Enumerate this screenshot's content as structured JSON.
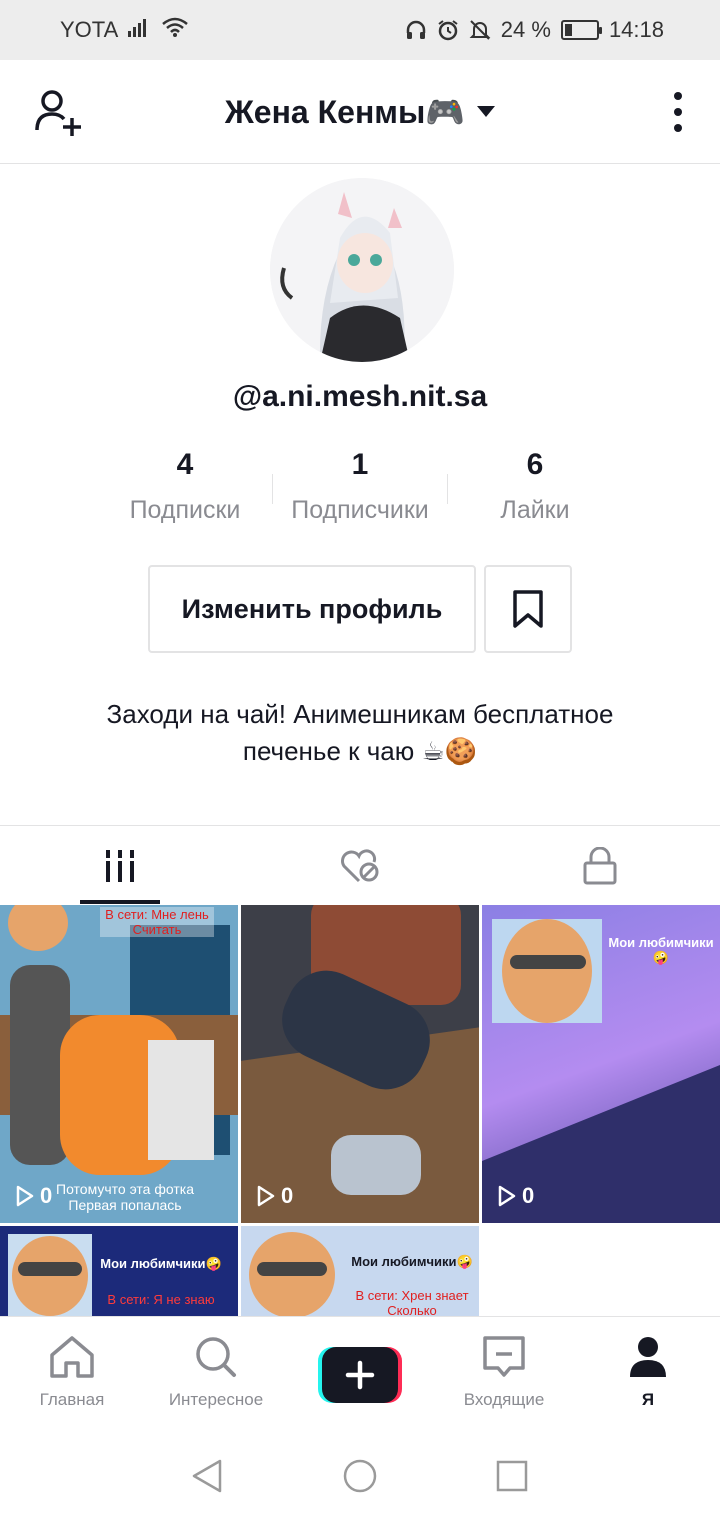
{
  "status_bar": {
    "carrier": "YOTA",
    "battery": "24 %",
    "battery_level": 0.24,
    "time": "14:18"
  },
  "header": {
    "title": "Жена Кенмы🎮",
    "icons": [
      "add-user-icon",
      "caret-down-icon",
      "more-vertical-icon"
    ]
  },
  "profile": {
    "username": "@a.ni.mesh.nit.sa",
    "stats": [
      {
        "value": "4",
        "label": "Подписки"
      },
      {
        "value": "1",
        "label": "Подписчики"
      },
      {
        "value": "6",
        "label": "Лайки"
      }
    ],
    "edit_button": "Изменить профиль",
    "bio_line1": "Заходи на чай! Анимешникам бесплатное",
    "bio_line2": "печенье к чаю ☕🍪"
  },
  "tabs": {
    "icons": [
      "grid-icon",
      "liked-icon",
      "lock-icon"
    ],
    "active": 0
  },
  "videos": [
    {
      "views": "0",
      "top_caption": "В сети: Мне лень Считать",
      "bottom_caption_1": "Потомучто эта фотка",
      "bottom_caption_2": "Первая попалась"
    },
    {
      "views": "0"
    },
    {
      "views": "0",
      "top_caption": "Мои любимчики🤪"
    },
    {
      "top_caption": "Мои любимчики🤪",
      "bottom_caption": "В сети: Я не знаю"
    },
    {
      "top_caption": "Мои любимчики🤪",
      "bottom_caption": "В сети: Хрен знает Сколько"
    }
  ],
  "bottom_nav": [
    {
      "label": "Главная",
      "icon": "home-icon"
    },
    {
      "label": "Интересное",
      "icon": "search-icon"
    },
    {
      "label": "",
      "icon": "create-icon"
    },
    {
      "label": "Входящие",
      "icon": "inbox-icon"
    },
    {
      "label": "Я",
      "icon": "profile-icon"
    }
  ],
  "colors": {
    "text": "#161823",
    "muted": "#8a8b91",
    "border": "#e3e3e4",
    "accent_cyan": "#25f4ee",
    "accent_red": "#fe2c55"
  }
}
